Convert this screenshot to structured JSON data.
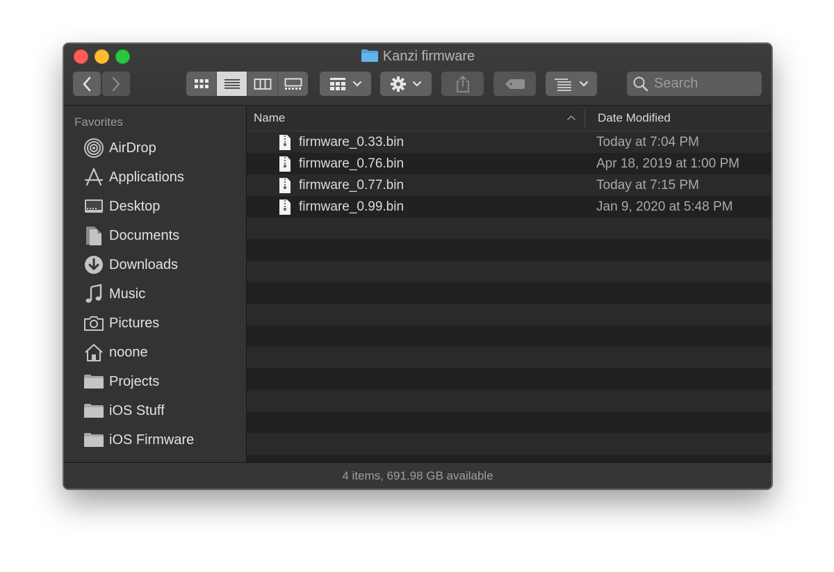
{
  "window": {
    "title": "Kanzi firmware"
  },
  "toolbar": {
    "back_icon": "chevron-left-icon",
    "forward_icon": "chevron-right-icon",
    "view_modes": [
      "icon-view",
      "list-view",
      "column-view",
      "gallery-view"
    ],
    "active_view": "list-view",
    "search_placeholder": "Search"
  },
  "sidebar": {
    "heading": "Favorites",
    "items": [
      {
        "label": "AirDrop",
        "icon": "airdrop-icon"
      },
      {
        "label": "Applications",
        "icon": "applications-icon"
      },
      {
        "label": "Desktop",
        "icon": "desktop-icon"
      },
      {
        "label": "Documents",
        "icon": "documents-icon"
      },
      {
        "label": "Downloads",
        "icon": "downloads-icon"
      },
      {
        "label": "Music",
        "icon": "music-icon"
      },
      {
        "label": "Pictures",
        "icon": "camera-icon"
      },
      {
        "label": "noone",
        "icon": "home-icon"
      },
      {
        "label": "Projects",
        "icon": "folder-icon"
      },
      {
        "label": "iOS Stuff",
        "icon": "folder-icon"
      },
      {
        "label": "iOS Firmware",
        "icon": "folder-icon"
      }
    ]
  },
  "list": {
    "columns": {
      "name": "Name",
      "date": "Date Modified"
    },
    "files": [
      {
        "name": "firmware_0.33.bin",
        "date": "Today at 7:04 PM"
      },
      {
        "name": "firmware_0.76.bin",
        "date": "Apr 18, 2019 at 1:00 PM"
      },
      {
        "name": "firmware_0.77.bin",
        "date": "Today at 7:15 PM"
      },
      {
        "name": "firmware_0.99.bin",
        "date": "Jan 9, 2020 at 5:48 PM"
      }
    ]
  },
  "status": {
    "text": "4 items, 691.98 GB available"
  },
  "colors": {
    "close": "#fe5f57",
    "minimize": "#febc2e",
    "maximize": "#28c840",
    "folder_accent": "#4fa3dc"
  }
}
